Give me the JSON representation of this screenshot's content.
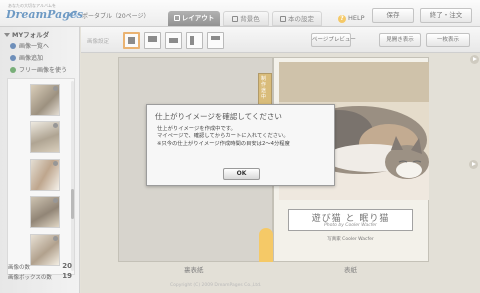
{
  "header": {
    "brand_small": "あなたの大切なアルバムを",
    "brand": "DreamPages",
    "product": "ポータブル（20ページ）",
    "tabs": [
      {
        "label": "レイアウト"
      },
      {
        "label": "背景色"
      },
      {
        "label": "本の設定"
      }
    ],
    "help": "HELP",
    "help_glyph": "?",
    "save": "保存",
    "exit": "終了・注文"
  },
  "sidebar": {
    "folder": "MYフォルダ",
    "items": [
      {
        "label": "画像一覧へ"
      },
      {
        "label": "画像追加"
      },
      {
        "label": "フリー画像を使う"
      }
    ],
    "stats": [
      {
        "label": "画像の数",
        "value": "20"
      },
      {
        "label": "画像ボックスの数",
        "value": "19"
      }
    ]
  },
  "toolbar": {
    "label": "画像設定",
    "preview": "ページプレビュー",
    "toggle": "見開き表示",
    "single": "一枚表示"
  },
  "book": {
    "spine": "制作途中",
    "title": "遊び猫 と 眠り猫",
    "subtitle": "Photo by Cooler Wacfer",
    "credit": "写真家 Cooler Wacfer",
    "back_label": "裏表紙",
    "front_label": "表紙",
    "copyright": "Copyright (C) 2009 DreamPages Co.,Ltd."
  },
  "dialog": {
    "title": "仕上がりイメージを確認してください",
    "lines": [
      "仕上がりイメージを作成中です。",
      "マイページで、確認してからカートに入れてください。",
      "※只今の仕上がりイメージ作成時間の目安は2〜4分程度"
    ],
    "ok": "OK"
  }
}
